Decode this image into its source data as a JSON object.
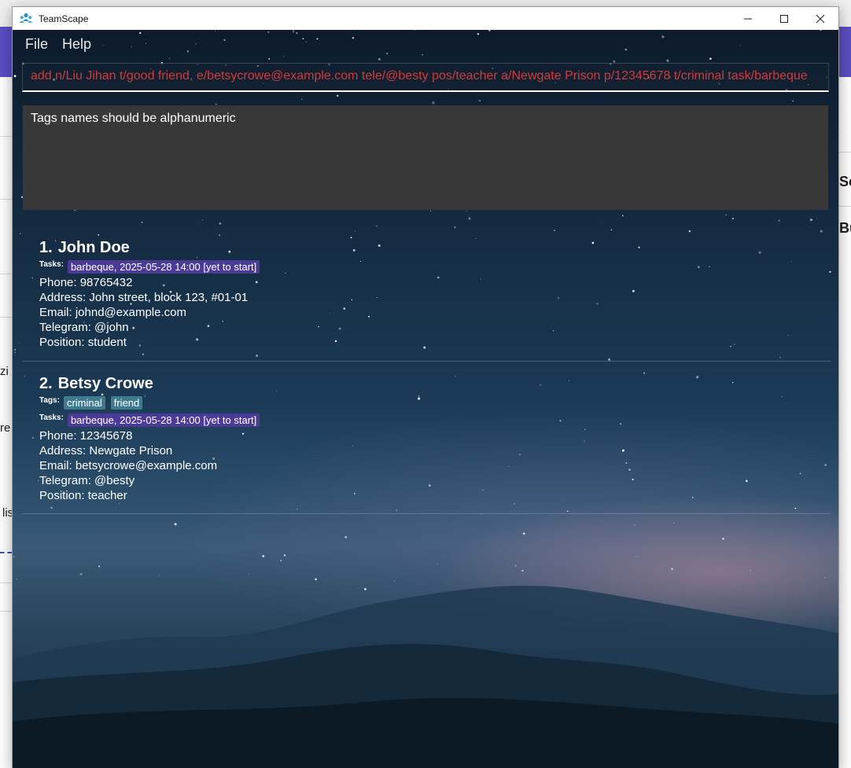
{
  "window": {
    "title": "TeamScape"
  },
  "menu": {
    "file": "File",
    "help": "Help"
  },
  "command_box": {
    "value": "add n/Liu Jihan t/good friend, e/betsycrowe@example.com tele/@besty pos/teacher a/Newgate Prison p/12345678 t/criminal task/barbeque",
    "text_color": "#d23a3a"
  },
  "result_display": {
    "message": "Tags names should be alphanumeric"
  },
  "labels": {
    "tags": "Tags:",
    "tasks": "Tasks:",
    "phone": "Phone: ",
    "address": "Address: ",
    "email": "Email: ",
    "telegram": "Telegram: ",
    "position": "Position: "
  },
  "persons": [
    {
      "index": "1.",
      "name": "John Doe",
      "tags": [],
      "tasks": [
        "barbeque, 2025-05-28 14:00 [yet to start]"
      ],
      "phone": "98765432",
      "address": "John street, block 123, #01-01",
      "email": "johnd@example.com",
      "telegram": "@john",
      "position": "student"
    },
    {
      "index": "2.",
      "name": "Betsy Crowe",
      "tags": [
        "criminal",
        "friend"
      ],
      "tasks": [
        "barbeque, 2025-05-28 14:00 [yet to start]"
      ],
      "phone": "12345678",
      "address": "Newgate Prison",
      "email": "betsycrowe@example.com",
      "telegram": "@besty",
      "position": "teacher"
    }
  ],
  "background_app": {
    "fragments_right": [
      "Sc",
      "Bu"
    ],
    "fragments_left": [
      "zi",
      "re",
      "lis"
    ]
  },
  "colors": {
    "tag_chip": "#3e7b91",
    "task_chip": "#4b3a96",
    "result_box": "#383838"
  }
}
